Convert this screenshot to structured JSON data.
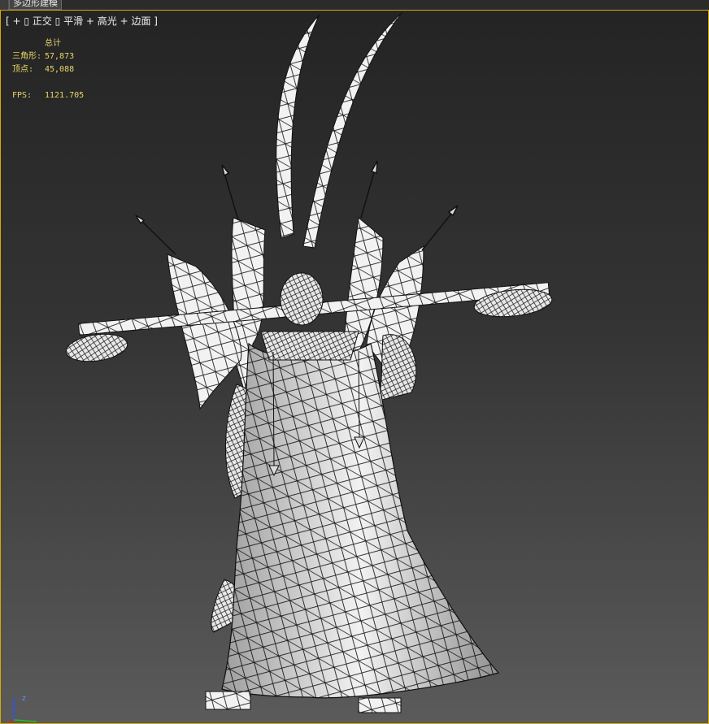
{
  "topbar": {
    "tab_label": "多边形建模"
  },
  "viewport": {
    "label": {
      "open": "[",
      "plus": "+",
      "view": "正交",
      "shading": "平滑 + 高光",
      "edges": "边面",
      "close": "]"
    },
    "stats": {
      "header": "总计",
      "triangles_label": "三角形:",
      "triangles_value": "57,873",
      "vertices_label": "顶点:",
      "vertices_value": "45,088",
      "fps_label": "FPS:",
      "fps_value": "1121.705"
    },
    "axis": {
      "z_label": "z"
    }
  },
  "colors": {
    "viewport_border": "#d9a900",
    "stats_text": "#e8d66a",
    "mesh_fill": "#f4f4f4",
    "wire": "#111111",
    "axis_x": "#d62020",
    "axis_y": "#20c020",
    "axis_z": "#3050ff"
  }
}
